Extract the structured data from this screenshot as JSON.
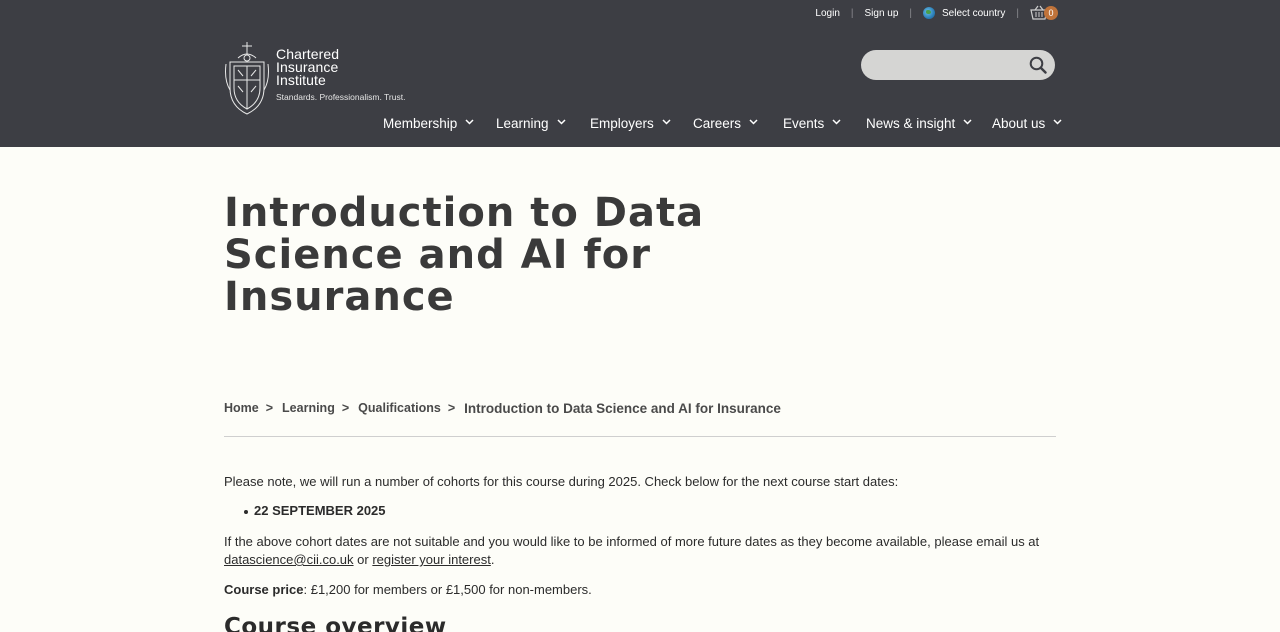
{
  "utility": {
    "login": "Login",
    "signup": "Sign up",
    "country": "Select country",
    "basket_count": "0"
  },
  "logo": {
    "line1": "Chartered",
    "line2": "Insurance",
    "line3": "Institute",
    "tagline": "Standards. Professionalism. Trust."
  },
  "search": {
    "placeholder": ""
  },
  "nav": {
    "items": [
      {
        "label": "Membership"
      },
      {
        "label": "Learning"
      },
      {
        "label": "Employers"
      },
      {
        "label": "Careers"
      },
      {
        "label": "Events"
      },
      {
        "label": "News & insight"
      },
      {
        "label": "About us"
      }
    ]
  },
  "page": {
    "title": "Introduction to Data Science and AI for Insurance"
  },
  "breadcrumb": {
    "home": "Home",
    "learning": "Learning",
    "qualifications": "Qualifications",
    "separator": ">",
    "current": "Introduction to Data Science and AI for Insurance"
  },
  "content": {
    "intro": "Please note, we will run a number of cohorts for this course during 2025. Check below for the next course start dates:",
    "dates": [
      "22 SEPTEMBER 2025"
    ],
    "future_text": "If the above cohort dates are not suitable and you would like to be informed of more future dates as they become available, please email us at",
    "email_link": "datascience@cii.co.uk",
    "or_text": " or ",
    "register_link": "register your interest",
    "period": ".",
    "price_label": "Course price",
    "price_text": ": £1,200 for members or £1,500 for non-members.",
    "overview_heading": "Course overview"
  },
  "colors": {
    "header_bg": "#3d3e44",
    "page_bg": "#fdfdf8",
    "basket_badge": "#c0733a"
  }
}
